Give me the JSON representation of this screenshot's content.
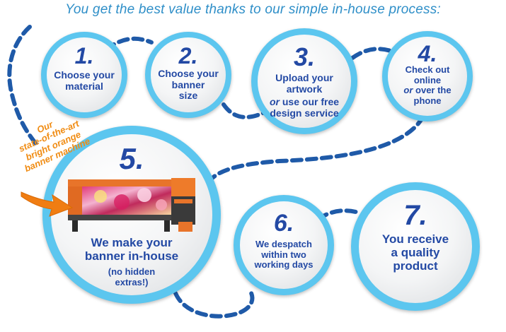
{
  "headline": "You get the best value thanks to our simple in-house process:",
  "callout": {
    "lines": [
      "Our",
      "state-of-the-art",
      "bright orange",
      "banner machine"
    ]
  },
  "steps": [
    {
      "num": "1.",
      "lines": [
        "Choose your",
        "material"
      ]
    },
    {
      "num": "2.",
      "lines": [
        "Choose your",
        "banner",
        "size"
      ]
    },
    {
      "num": "3.",
      "lines": [
        "Upload your",
        "artwork"
      ],
      "or_prefix": "or",
      "or_rest": " use our free",
      "extra": "design service"
    },
    {
      "num": "4.",
      "lines": [
        "Check out",
        "online"
      ],
      "or_prefix": "or",
      "or_rest": " over the",
      "extra": "phone"
    },
    {
      "num": "5.",
      "lines": [
        "We make your",
        "banner in-house"
      ],
      "sub": [
        "(no hidden",
        "extras!)"
      ]
    },
    {
      "num": "6.",
      "lines": [
        "We despatch",
        "within two",
        "working days"
      ]
    },
    {
      "num": "7.",
      "lines": [
        "You receive",
        "a quality",
        "product"
      ]
    }
  ],
  "colors": {
    "ring": "#5cc6ef",
    "dash": "#1f5aa8",
    "text": "#2349a4",
    "accent": "#f08c14"
  }
}
